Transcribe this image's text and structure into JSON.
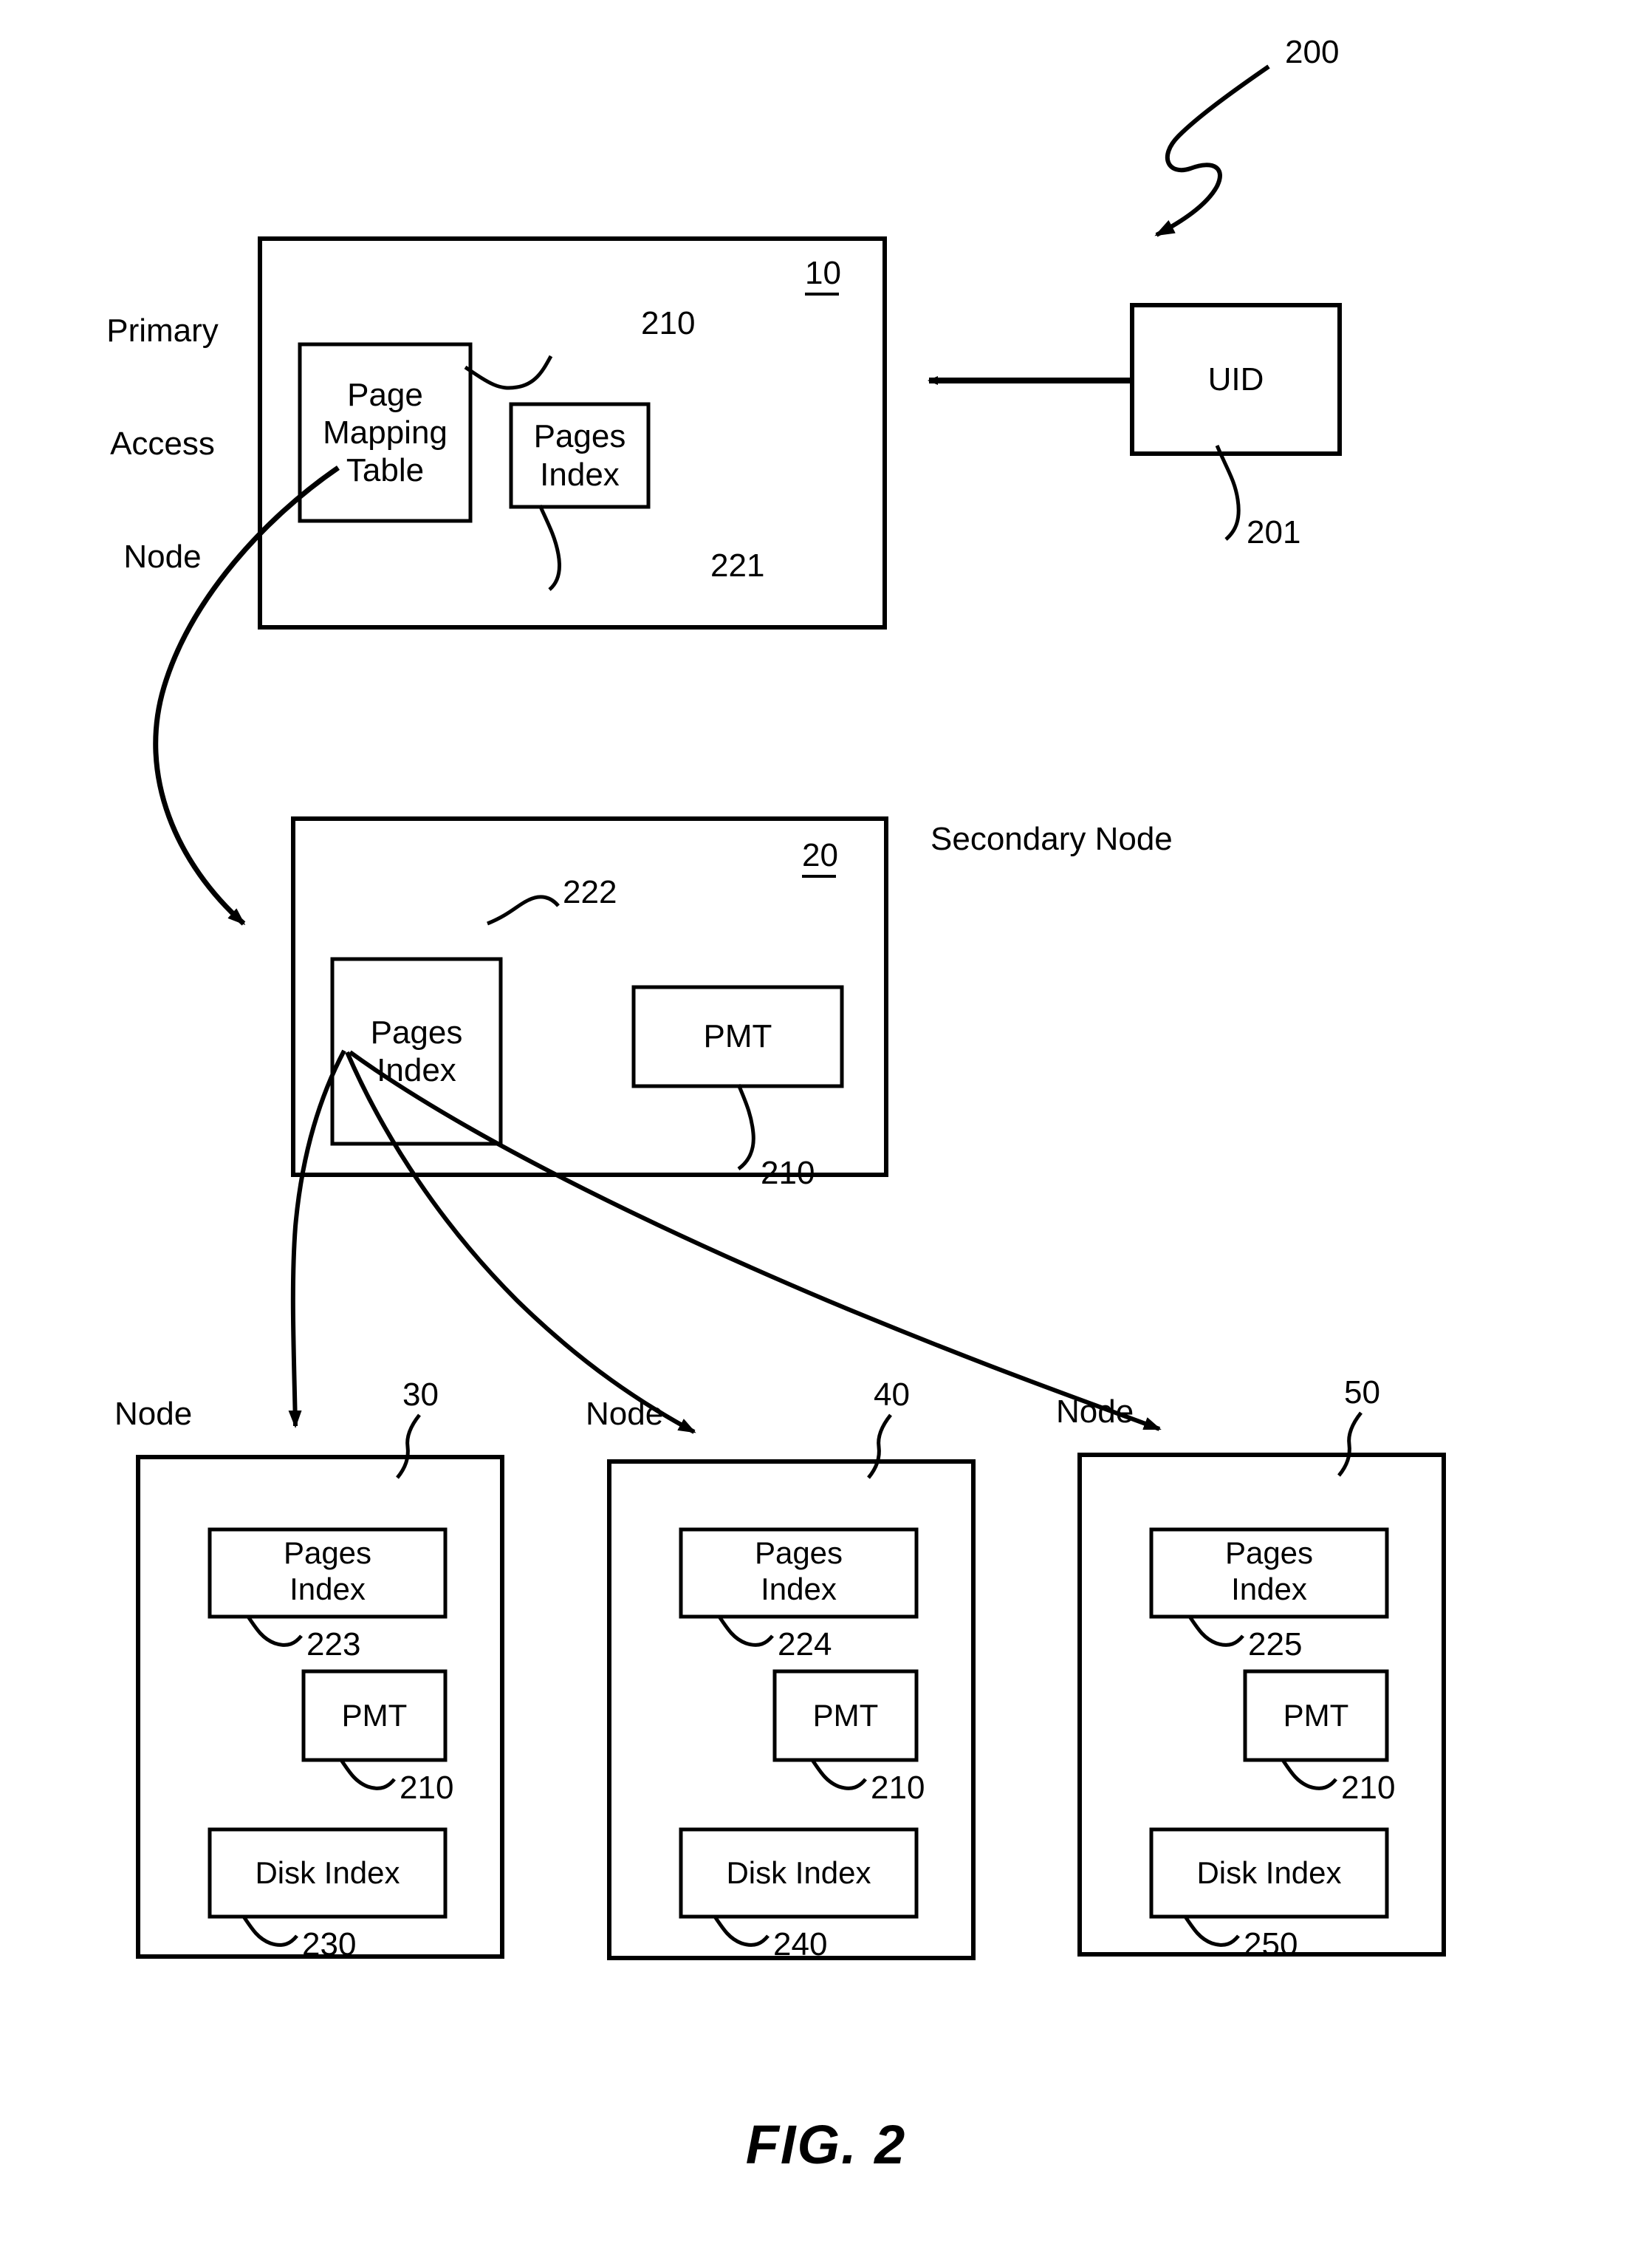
{
  "figure": {
    "caption": "FIG. 2",
    "system_ref": "200"
  },
  "primary_access_node": {
    "label": "Primary\nAccess\nNode",
    "label_line1": "Primary",
    "label_line2": "Access",
    "label_line3": "Node",
    "ref": "10",
    "page_mapping_table": {
      "line1": "Page",
      "line2": "Mapping",
      "line3": "Table",
      "ref": "210"
    },
    "pages_index": {
      "line1": "Pages",
      "line2": "Index",
      "ref": "221"
    }
  },
  "uid": {
    "label": "UID",
    "ref": "201"
  },
  "secondary_node": {
    "label": "Secondary Node",
    "ref": "20",
    "pages_index": {
      "line1": "Pages",
      "line2": "Index",
      "ref": "222"
    },
    "pmt": {
      "label": "PMT",
      "ref": "210"
    }
  },
  "nodes": [
    {
      "label": "Node",
      "ref": "30",
      "pages_index": {
        "line1": "Pages",
        "line2": "Index",
        "ref": "223"
      },
      "pmt": {
        "label": "PMT",
        "ref": "210"
      },
      "disk_index": {
        "label": "Disk Index",
        "ref": "230"
      }
    },
    {
      "label": "Node",
      "ref": "40",
      "pages_index": {
        "line1": "Pages",
        "line2": "Index",
        "ref": "224"
      },
      "pmt": {
        "label": "PMT",
        "ref": "210"
      },
      "disk_index": {
        "label": "Disk Index",
        "ref": "240"
      }
    },
    {
      "label": "Node",
      "ref": "50",
      "pages_index": {
        "line1": "Pages",
        "line2": "Index",
        "ref": "225"
      },
      "pmt": {
        "label": "PMT",
        "ref": "210"
      },
      "disk_index": {
        "label": "Disk Index",
        "ref": "250"
      }
    }
  ],
  "colors": {
    "ink": "#000000",
    "paper": "#ffffff"
  }
}
